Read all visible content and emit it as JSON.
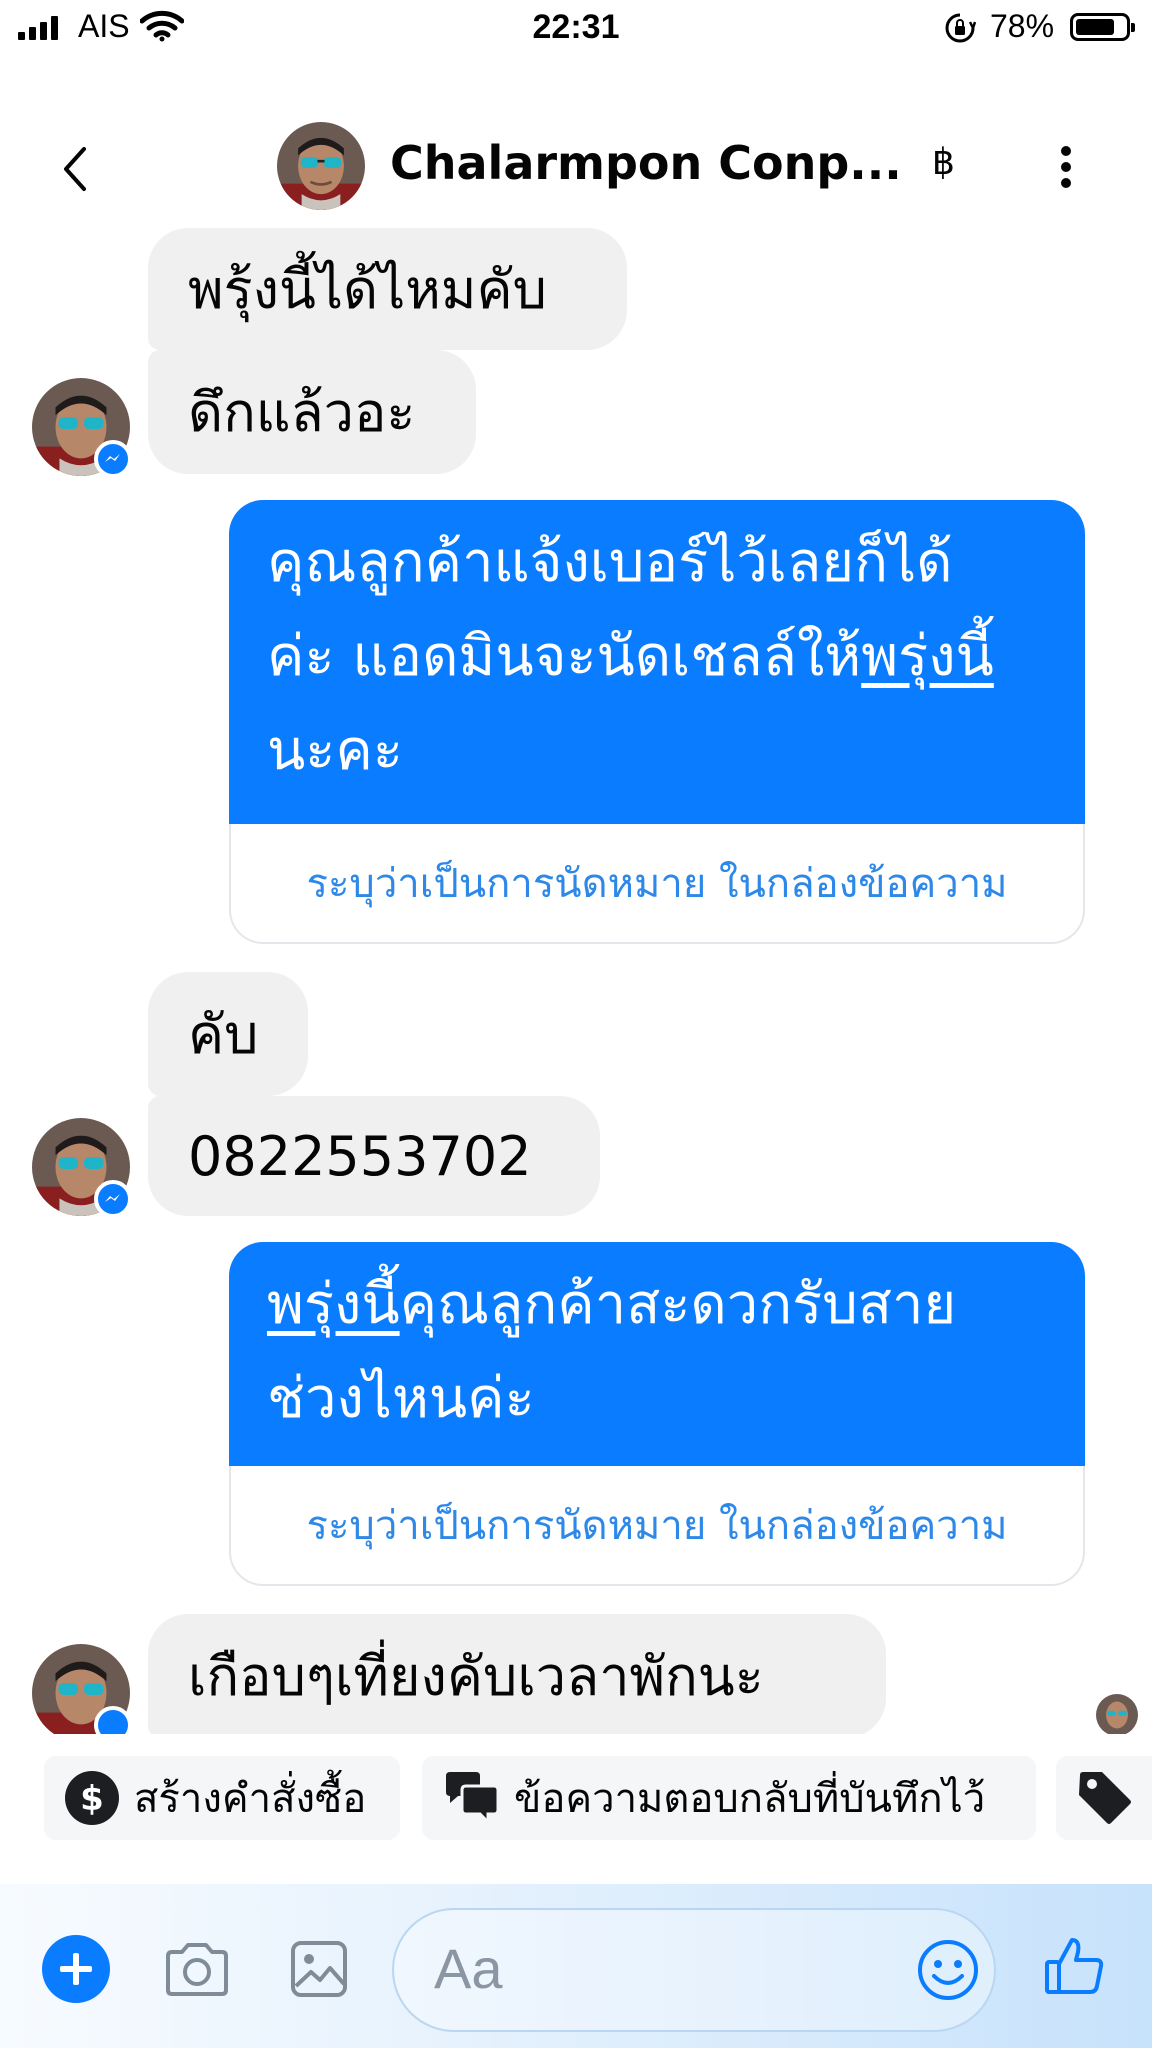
{
  "status_bar": {
    "carrier": "AIS",
    "time": "22:31",
    "battery_percent": "78%"
  },
  "header": {
    "contact_name": "Chalarmpon Conp...",
    "currency_symbol": "฿"
  },
  "messages": {
    "m1": "พรุ้งนี้ได้ไหมคับ",
    "m2": "ดึกแล้วอะ",
    "o1_line1": "คุณลูกค้าแจ้งเบอร์ไว้เลยก็ได้",
    "o1_line2_pre": "ค่ะ แอดมินจะนัดเชลล์ให้",
    "o1_line2_link": "พรุ่งนี้",
    "o1_line3": "นะคะ",
    "o1_footer": "ระบุว่าเป็นการนัดหมาย ในกล่องข้อความ",
    "m3": "คับ",
    "m4": "0822553702",
    "o2_link": "พรุ่งนี้",
    "o2_line1_rest": "คุณลูกค้าสะดวกรับสาย",
    "o2_line2": "ช่วงไหนค่ะ",
    "o2_footer": "ระบุว่าเป็นการนัดหมาย ในกล่องข้อความ",
    "m5": "เกือบๆเที่ยงคับเวลาพักนะ"
  },
  "quick_replies": {
    "create_order": "สร้างคำสั่งซื้อ",
    "saved_replies": "ข้อความตอบกลับที่บันทึกไว้"
  },
  "composer": {
    "placeholder": "Aa"
  },
  "colors": {
    "accent": "#0a7cff",
    "incoming_bubble": "#f0f0f0",
    "link_text": "#2d88e8"
  }
}
